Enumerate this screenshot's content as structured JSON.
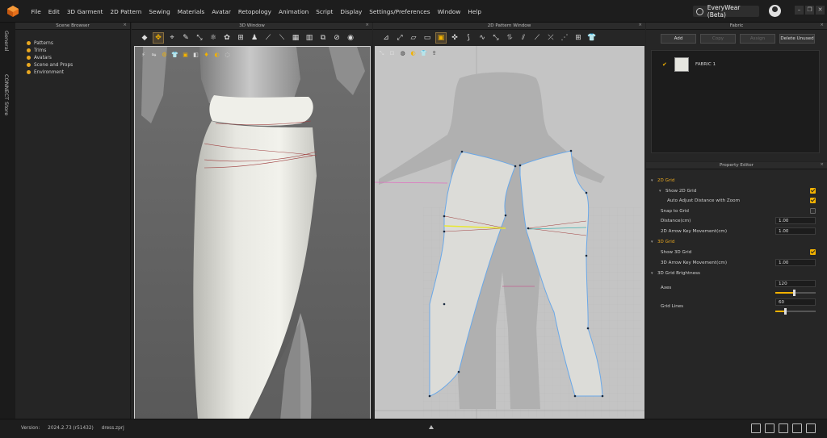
{
  "menubar": {
    "items": [
      "File",
      "Edit",
      "3D Garment",
      "2D Pattern",
      "Sewing",
      "Materials",
      "Avatar",
      "Retopology",
      "Animation",
      "Script",
      "Display",
      "Settings/Preferences",
      "Window",
      "Help"
    ],
    "app_name": "EveryWear (Beta)"
  },
  "side_tabs": [
    "General",
    "CONNECT Store"
  ],
  "scene_browser": {
    "title": "Scene Browser",
    "items": [
      "Patterns",
      "Trims",
      "Avatars",
      "Scene and Props",
      "Environment"
    ]
  },
  "window3d": {
    "title": "3D Window"
  },
  "window2d": {
    "title": "2D Pattern Window"
  },
  "fabric": {
    "title": "Fabric",
    "buttons": {
      "add": "Add",
      "copy": "Copy",
      "assign": "Assign",
      "delete_unused": "Delete Unused"
    },
    "items": [
      {
        "name": "FABRIC 1",
        "checked": true,
        "swatch_color": "#e6e6e0"
      }
    ]
  },
  "property_editor": {
    "title": "Property Editor",
    "grid2d_section": "2D Grid",
    "show_2d_grid": "Show 2D Grid",
    "auto_adjust": "Auto Adjust Distance with Zoom",
    "snap_to_grid": "Snap to Grid",
    "distance_label": "Distance(cm)",
    "distance_value": "1.00",
    "arrow2d_label": "2D Arrow Key Movement(cm)",
    "arrow2d_value": "1.00",
    "grid3d_section": "3D Grid",
    "show_3d_grid": "Show 3D Grid",
    "arrow3d_label": "3D Arrow Key Movement(cm)",
    "arrow3d_value": "1.00",
    "brightness_section": "3D Grid Brightness",
    "axes_label": "Axes",
    "axes_value": "120",
    "axes_fraction": 0.47,
    "gridlines_label": "Grid Lines",
    "gridlines_value": "60",
    "gridlines_fraction": 0.24
  },
  "statusbar": {
    "version_label": "Version:",
    "version_value": "2024.2.73 (r51432)",
    "file": "dress.zprj"
  },
  "colors": {
    "accent": "#f2b200",
    "pattern_outline": "#6aa8e8",
    "seam_highlight": "#e8e830"
  }
}
